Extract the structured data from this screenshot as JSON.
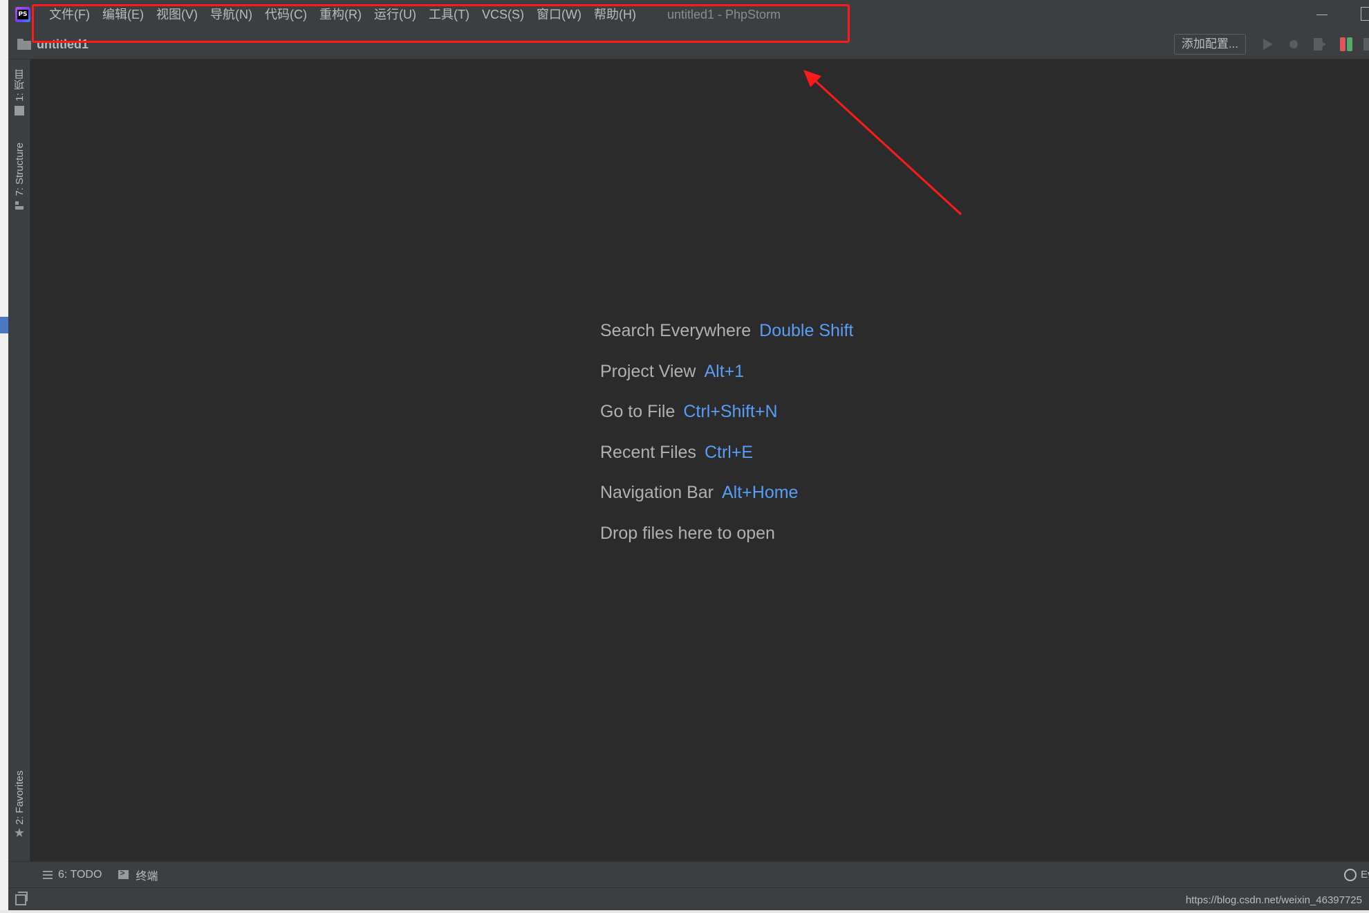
{
  "window": {
    "title": "untitled1 - PhpStorm"
  },
  "menu": {
    "items": [
      {
        "label": "文件(F)"
      },
      {
        "label": "编辑(E)"
      },
      {
        "label": "视图(V)"
      },
      {
        "label": "导航(N)"
      },
      {
        "label": "代码(C)"
      },
      {
        "label": "重构(R)"
      },
      {
        "label": "运行(U)"
      },
      {
        "label": "工具(T)"
      },
      {
        "label": "VCS(S)"
      },
      {
        "label": "窗口(W)"
      },
      {
        "label": "帮助(H)"
      }
    ]
  },
  "navbar": {
    "project_name": "untitled1",
    "add_config_label": "添加配置...",
    "icons": [
      "run-icon",
      "debug-icon",
      "coverage-icon",
      "vcs-icon"
    ]
  },
  "left_tool_windows": [
    {
      "label": "1: 项目",
      "icon": "folder-icon"
    },
    {
      "label": "7: Structure",
      "icon": "structure-icon"
    },
    {
      "label": "2: Favorites",
      "icon": "star-icon"
    }
  ],
  "editor": {
    "hints": [
      {
        "label": "Search Everywhere",
        "shortcut": "Double Shift"
      },
      {
        "label": "Project View",
        "shortcut": "Alt+1"
      },
      {
        "label": "Go to File",
        "shortcut": "Ctrl+Shift+N"
      },
      {
        "label": "Recent Files",
        "shortcut": "Ctrl+E"
      },
      {
        "label": "Navigation Bar",
        "shortcut": "Alt+Home"
      },
      {
        "label": "Drop files here to open",
        "shortcut": ""
      }
    ]
  },
  "bottom_tool_windows": [
    {
      "label": "6: TODO",
      "icon": "list-icon"
    },
    {
      "label": "终端",
      "icon": "terminal-icon"
    }
  ],
  "bottom_right": {
    "event_log_label": "Ev"
  },
  "statusbar": {
    "watermark": "https://blog.csdn.net/weixin_46397725"
  },
  "colors": {
    "background": "#2b2b2b",
    "chrome": "#3c3f41",
    "shortcut_blue": "#589df6",
    "annotation_red": "#ff1a1a"
  }
}
